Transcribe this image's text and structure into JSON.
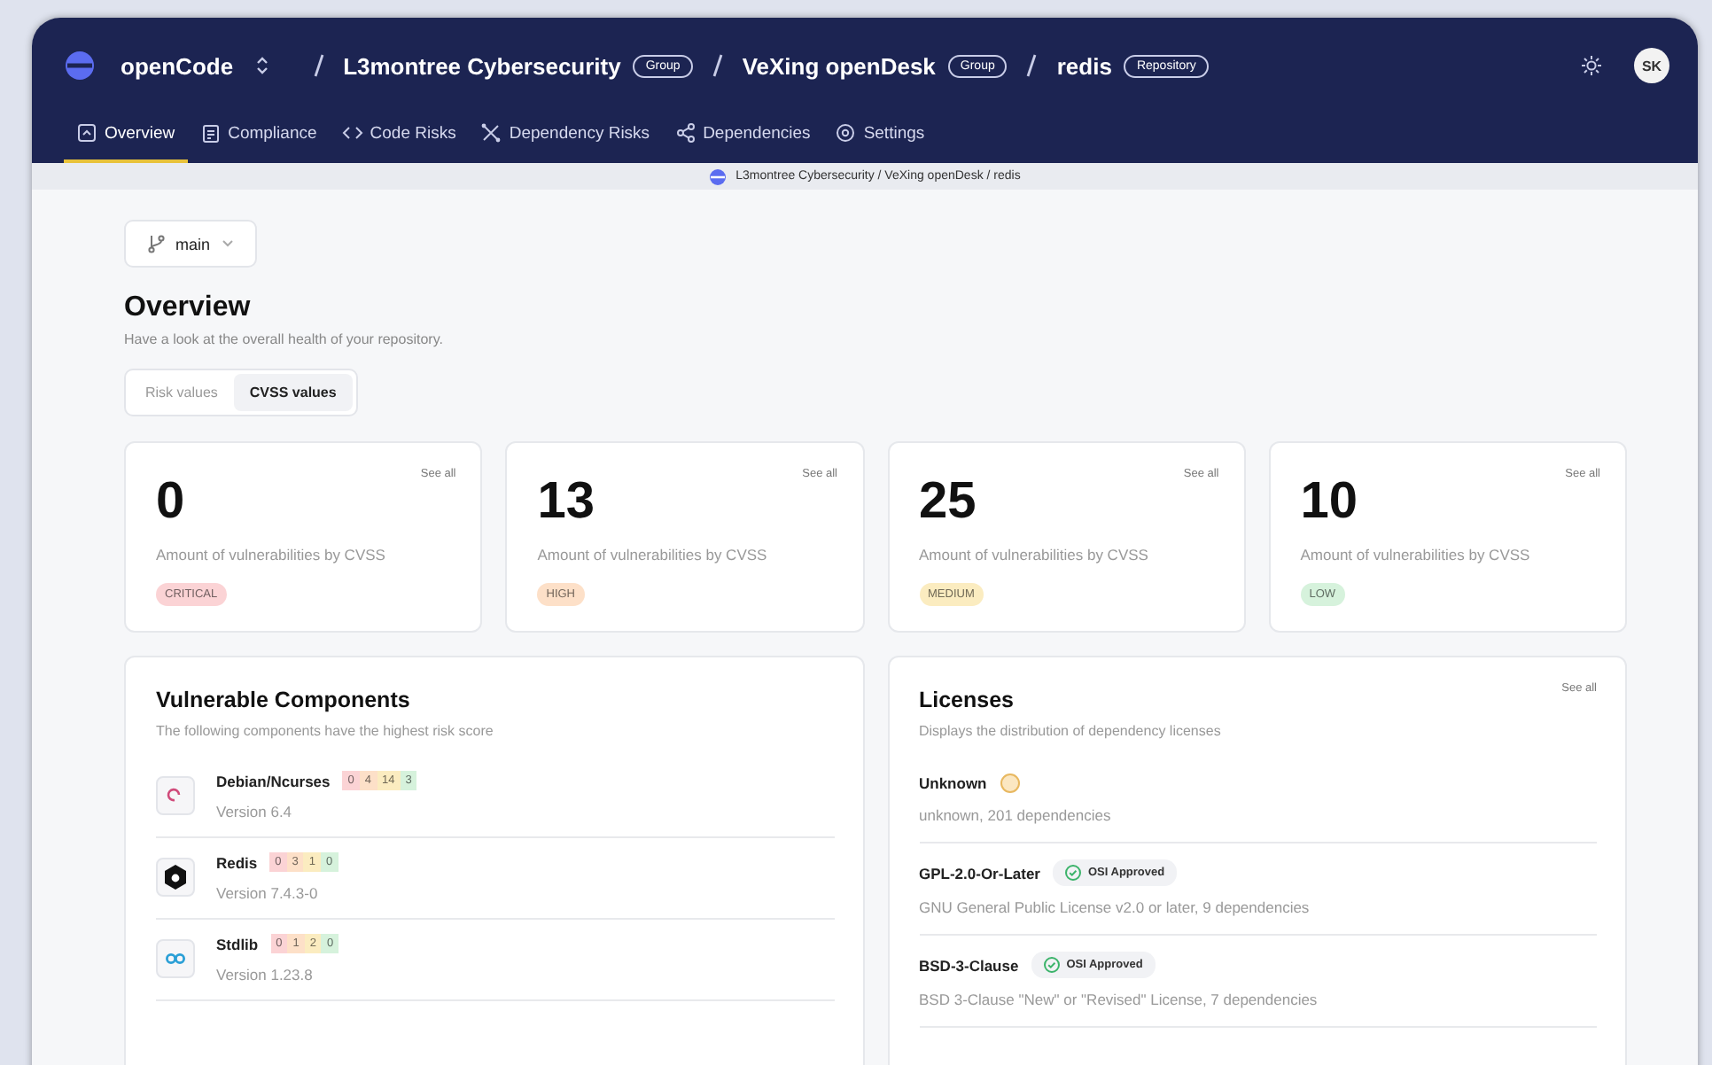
{
  "header": {
    "product": "openCode",
    "crumbs": [
      {
        "name": "L3montree Cybersecurity",
        "tag": "Group"
      },
      {
        "name": "VeXing openDesk",
        "tag": "Group"
      },
      {
        "name": "redis",
        "tag": "Repository"
      }
    ],
    "avatar": "SK"
  },
  "tabs": [
    {
      "label": "Overview",
      "selected": true
    },
    {
      "label": "Compliance",
      "selected": false
    },
    {
      "label": "Code Risks",
      "selected": false
    },
    {
      "label": "Dependency Risks",
      "selected": false
    },
    {
      "label": "Dependencies",
      "selected": false
    },
    {
      "label": "Settings",
      "selected": false
    }
  ],
  "path_bar": "L3montree Cybersecurity / VeXing openDesk / redis",
  "branch": "main",
  "overview": {
    "title": "Overview",
    "subtitle": "Have a look at the overall health of your repository.",
    "toggle": [
      {
        "label": "Risk values",
        "selected": false
      },
      {
        "label": "CVSS values",
        "selected": true
      }
    ]
  },
  "stat_cards": [
    {
      "value": "0",
      "caption": "Amount of vulnerabilities by CVSS",
      "color": "#fbd3d5",
      "badge": "CRITICAL",
      "link": "See all"
    },
    {
      "value": "13",
      "caption": "Amount of vulnerabilities by CVSS",
      "color": "#fde0c8",
      "badge": "HIGH",
      "link": "See all"
    },
    {
      "value": "25",
      "caption": "Amount of vulnerabilities by CVSS",
      "color": "#fbecc0",
      "badge": "MEDIUM",
      "link": "See all"
    },
    {
      "value": "10",
      "caption": "Amount of vulnerabilities by CVSS",
      "color": "#d6f2dc",
      "badge": "LOW",
      "link": "See all"
    }
  ],
  "components": {
    "title": "Vulnerable Components",
    "subtitle": "The following components have the highest risk score",
    "items": [
      {
        "name": "Debian/Ncurses",
        "version": "Version 6.4",
        "counts": [
          {
            "color": "#fbd3d5",
            "value": "0"
          },
          {
            "color": "#fde0c8",
            "value": "4"
          },
          {
            "color": "#fbecc0",
            "value": "14"
          },
          {
            "color": "#d6f2dc",
            "value": "3"
          }
        ]
      },
      {
        "name": "Redis",
        "version": "Version 7.4.3-0",
        "counts": [
          {
            "color": "#fbd3d5",
            "value": "0"
          },
          {
            "color": "#fde0c8",
            "value": "3"
          },
          {
            "color": "#fbecc0",
            "value": "1"
          },
          {
            "color": "#d6f2dc",
            "value": "0"
          }
        ]
      },
      {
        "name": "Stdlib",
        "version": "Version 1.23.8",
        "counts": [
          {
            "color": "#fbd3d5",
            "value": "0"
          },
          {
            "color": "#fde0c8",
            "value": "1"
          },
          {
            "color": "#fbecc0",
            "value": "2"
          },
          {
            "color": "#d6f2dc",
            "value": "0"
          }
        ]
      }
    ]
  },
  "licenses": {
    "title": "Licenses",
    "subtitle": "Displays the distribution of dependency licenses",
    "link": "See all",
    "items": [
      {
        "kind": "unknown",
        "name": "Unknown",
        "description": "unknown, 201 dependencies"
      },
      {
        "kind": "approved",
        "name": "GPL-2.0-Or-Later",
        "badge": "OSI Approved",
        "description": "GNU General Public License v2.0 or later, 9 dependencies"
      },
      {
        "kind": "approved",
        "name": "BSD-3-Clause",
        "badge": "OSI Approved",
        "description": "BSD 3-Clause \"New\" or \"Revised\" License, 7 dependencies"
      }
    ]
  }
}
